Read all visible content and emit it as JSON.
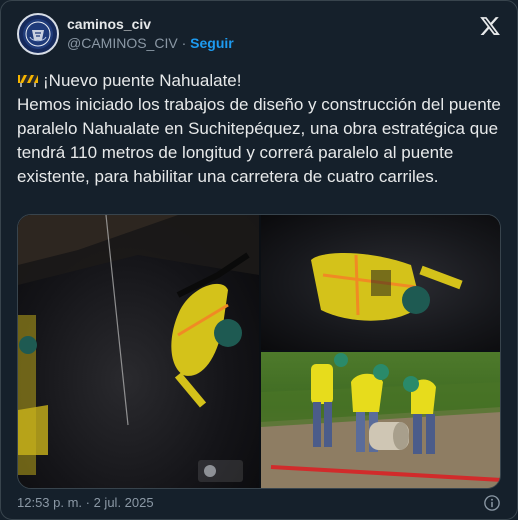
{
  "tweet": {
    "display_name": "caminos_civ",
    "handle": "@CAMINOS_CIV",
    "separator": "·",
    "follow_label": "Seguir",
    "headline": "¡Nuevo puente Nahualate!",
    "body": "Hemos iniciado los trabajos de diseño y construcción del puente paralelo Nahualate en Suchitepéquez, una obra estratégica que tendrá 110 metros de longitud y correrá paralelo al puente existente, para habilitar una carretera de cuatro carriles.",
    "timestamp": "12:53 p. m. · 2 jul. 2025"
  },
  "icons": {
    "brand": "x-logo-icon",
    "headline_emoji": "construction-icon",
    "info": "info-icon"
  },
  "colors": {
    "background": "#15202b",
    "accent": "#1d9bf0",
    "text": "#e7e9ea",
    "muted": "#8b98a5"
  }
}
